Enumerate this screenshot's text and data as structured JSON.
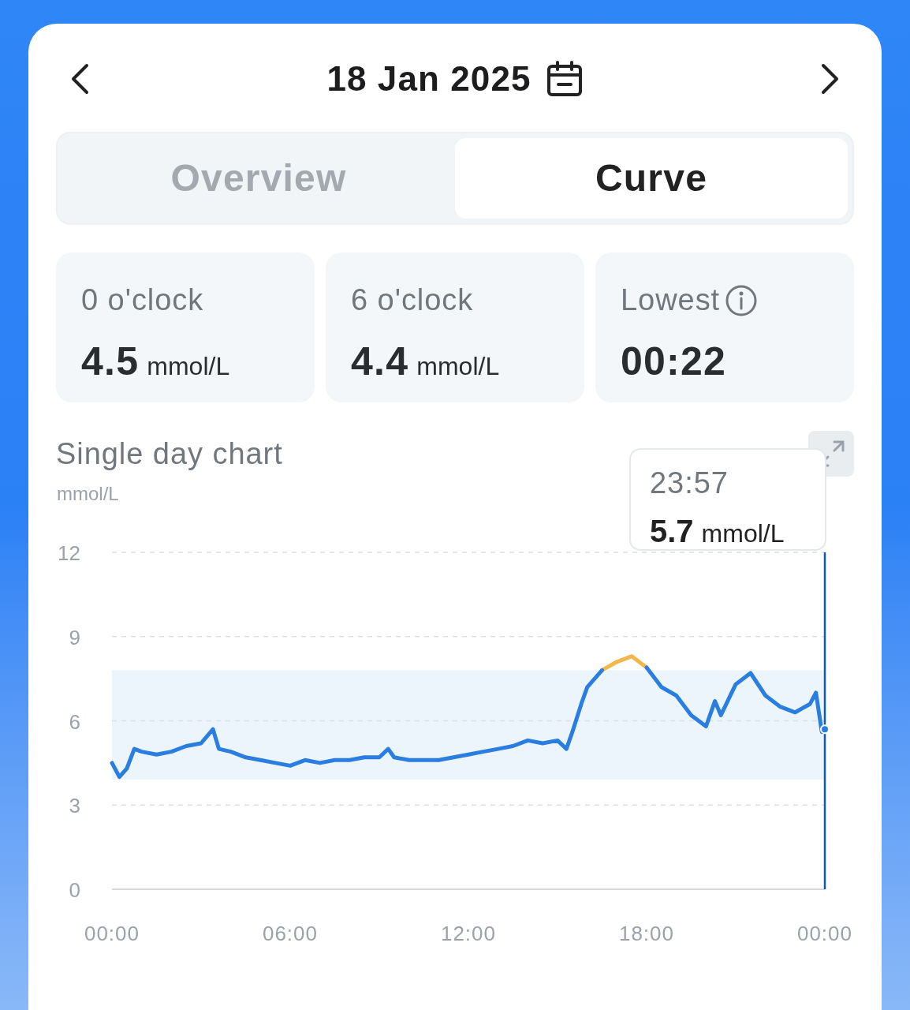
{
  "header": {
    "date": "18 Jan 2025"
  },
  "tabs": [
    {
      "label": "Overview",
      "selected": false
    },
    {
      "label": "Curve",
      "selected": true
    }
  ],
  "stats": [
    {
      "label": "0 o'clock",
      "value": "4.5",
      "unit": "mmol/L",
      "info": false
    },
    {
      "label": "6 o'clock",
      "value": "4.4",
      "unit": "mmol/L",
      "info": false
    },
    {
      "label": "Lowest",
      "value": "00:22",
      "info": true
    }
  ],
  "chart_section": {
    "title": "Single day chart",
    "tooltip": {
      "time": "23:57",
      "value": "5.7",
      "unit": "mmol/L"
    },
    "chart_data": {
      "type": "line",
      "ylabel": "mmol/L",
      "ylim": [
        0,
        12
      ],
      "xlim": [
        0,
        24
      ],
      "yticks": [
        0,
        3,
        6,
        9,
        12
      ],
      "grid": true,
      "xticks": [
        {
          "value": 0,
          "label": "00:00"
        },
        {
          "value": 6,
          "label": "06:00"
        },
        {
          "value": 12,
          "label": "12:00"
        },
        {
          "value": 18,
          "label": "18:00"
        },
        {
          "value": 24,
          "label": "00:00"
        }
      ],
      "x": [
        0,
        0.25,
        0.5,
        0.75,
        1,
        1.5,
        2,
        2.5,
        3,
        3.4,
        3.6,
        4,
        4.5,
        5,
        5.5,
        6,
        6.5,
        7,
        7.5,
        8,
        8.5,
        9,
        9.3,
        9.5,
        10,
        10.5,
        11,
        11.5,
        12,
        12.5,
        13,
        13.5,
        14,
        14.5,
        15,
        15.3,
        15.5,
        15.8,
        16,
        16.5,
        17,
        17.5,
        18,
        18.5,
        19,
        19.5,
        20,
        20.3,
        20.5,
        21,
        21.5,
        22,
        22.5,
        23,
        23.5,
        23.7,
        23.9,
        24
      ],
      "series": [
        {
          "color": "#2a7de1",
          "values": [
            4.5,
            4.0,
            4.3,
            5.0,
            4.9,
            4.8,
            4.9,
            5.1,
            5.2,
            5.7,
            5.0,
            4.9,
            4.7,
            4.6,
            4.5,
            4.4,
            4.6,
            4.5,
            4.6,
            4.6,
            4.7,
            4.7,
            5.0,
            4.7,
            4.6,
            4.6,
            4.6,
            4.7,
            4.8,
            4.9,
            5.0,
            5.1,
            5.3,
            5.2,
            5.3,
            5.0,
            5.6,
            6.6,
            7.2,
            7.8,
            null,
            null,
            7.9,
            7.2,
            6.9,
            6.2,
            5.8,
            6.7,
            6.2,
            7.3,
            7.7,
            6.9,
            6.5,
            6.3,
            6.6,
            7.0,
            5.6,
            5.7
          ]
        },
        {
          "color": "#f2b84b",
          "values": [
            null,
            null,
            null,
            null,
            null,
            null,
            null,
            null,
            null,
            null,
            null,
            null,
            null,
            null,
            null,
            null,
            null,
            null,
            null,
            null,
            null,
            null,
            null,
            null,
            null,
            null,
            null,
            null,
            null,
            null,
            null,
            null,
            null,
            null,
            null,
            null,
            null,
            null,
            null,
            7.8,
            8.1,
            8.3,
            7.9,
            null,
            null,
            null,
            null,
            null,
            null,
            null,
            null,
            null,
            null,
            null,
            null,
            null,
            null,
            null
          ]
        }
      ],
      "bands": [
        {
          "axis": "y",
          "from": 3.9,
          "to": 7.8,
          "color": "#edf5fc"
        }
      ]
    }
  }
}
